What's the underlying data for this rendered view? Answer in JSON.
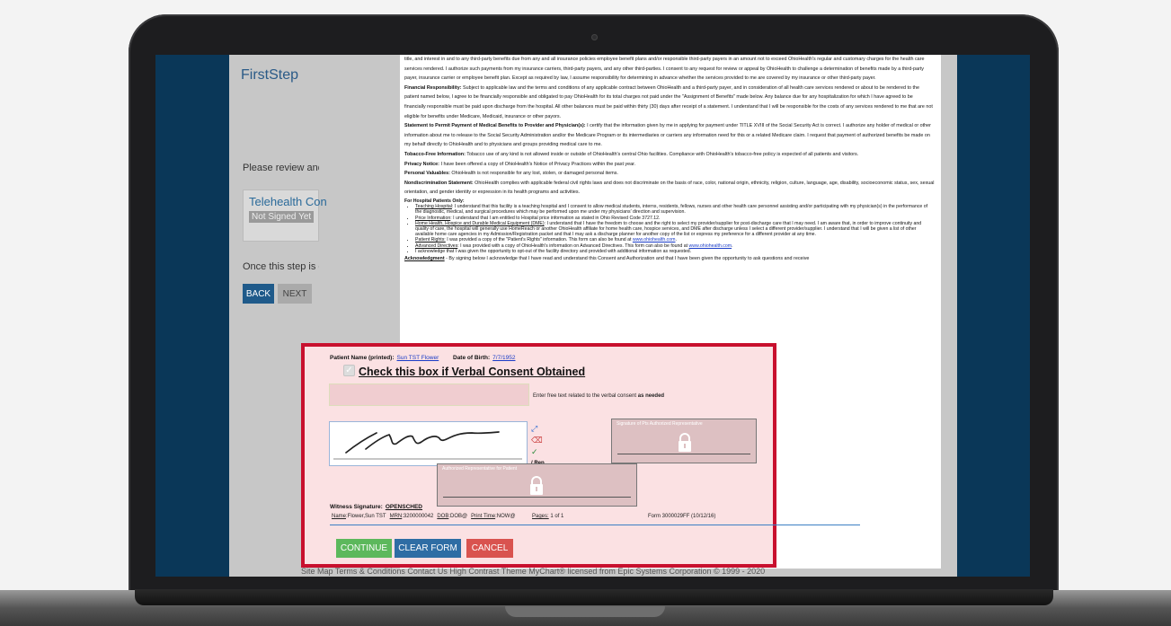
{
  "app": {
    "brand": "FirstStep",
    "review_text": "Please review and a",
    "doc_card_title": "Telehealth Con",
    "doc_card_status": "Not Signed Yet",
    "once_text": "Once this step is co",
    "back_label": "BACK",
    "next_label": "NEXT",
    "footer": "Site Map   Terms & Conditions   Contact Us   High Contrast Theme        MyChart® licensed from Epic Systems Corporation © 1999 - 2020"
  },
  "document": {
    "p1": "title, and interest in and to any third-party benefits due from any and all insurance policies employee benefit plans and/or responsible third-party payers in an amount not to exceed OhioHealth's regular and customary charges for the health care services rendered. I authorize such payments from my insurance carriers, third-party payers, and any other third-parties. I consent to any request for review or appeal by OhioHealth to challenge a determination of benefits made by a third-party payer, insurance carrier or employee benefit plan. Except as required by law, I assume responsibility for determining in advance whether the services provided to me are covered by my insurance or other third-party payer.",
    "financial_head": "Financial Responsibility:",
    "financial_body": " Subject to applicable law and the terms and conditions of any applicable contract between OhioHealth and a third-party payer, and in consideration of all health care services rendered or about to be rendered to the patient named below, I agree to be financially responsible and obligated to pay OhioHealth for its total charges not paid under the \"Assignment of Benefits\" made below. Any balance due for any hospitalization for which I have agreed to be financially responsible must be paid upon discharge from the hospital. All other balances must be paid within thirty (30) days after receipt of a statement. I understand that I will be responsible for the costs of any services rendered to me that are not eligible for benefits under Medicare, Medicaid, insurance or other payors.",
    "statement_head": "Statement to Permit Payment of Medical Benefits to Provider and Physician(s):",
    "statement_body": " I certify that the information given by me in applying for payment under TITLE XVIII of the Social Security Act is correct. I authorize any holder of medical or other information about me to release to the Social Security Administration and/or the Medicare Program or its intermediaries or carriers any information need for this or a related Medicare claim. I request that payment of authorized benefits be made on my behalf directly to OhioHealth and to physicians and groups providing medical care to me.",
    "tobacco_head": "Tobacco-Free Information:",
    "tobacco_body": " Tobacco use of any kind is not allowed inside or outside of OhioHealth's central Ohio facilities. Compliance with OhioHealth's tobacco-free policy is expected of all patients and visitors.",
    "privacy_head": "Privacy Notice:",
    "privacy_body": " I have been offered a copy of OhioHealth's Notice of Privacy Practices within the past year.",
    "valuables_head": "Personal Valuables:",
    "valuables_body": " OhioHealth is not responsible for any lost, stolen, or damaged personal items.",
    "nondisc_head": "Nondiscrimination Statement:",
    "nondisc_body": " OhioHealth complies with applicable federal civil rights laws and does not discriminate on the basis of race, color, national origin, ethnicity, religion, culture, language, age, disability, socioeconomic status, sex, sexual orientation, and gender identity or expression in its health programs and activities.",
    "hospital_head": "For Hospital Patients Only:",
    "b1_link": "Teaching Hospital",
    "b1_text": ": I understand that this facility is a teaching hospital and I consent to allow medical students, interns, residents, fellows, nurses and other health care personnel assisting and/or participating with my physician(s) in the performance of the diagnostic, medical, and surgical procedures which may be performed upon me under my physicians' direction and supervision.",
    "b2_link": "Price Information",
    "b2_text": ": I understand that I am entitled to Hospital price information as stated in Ohio Revised Code 3727.12.",
    "b3_link": "Home Health, Hospice and Durable Medical Equipment (DME)",
    "b3_text": ": I understand that I have the freedom to choose and the right to select my provider/supplier for post-discharge care that I may need.  I am aware that, in order to improve continuity and quality of care, the hospital will generally use HomeReach or another OhioHealth affiliate for home health care, hospice services, and DME after discharge unless I select a different provider/supplier.  I understand that I will be given a list of other available home care agencies in my Admission/Registration packet and that I may ask a discharge planner for another copy of the list or express my preference for a different provider at any time.",
    "b4_link": "Patient Rights:",
    "b4_text": "  I was provided a copy of the \"Patient's Rights\" information.  This form can also be found at ",
    "b4_url": "www.ohiohealth.com",
    "b5_link": "Advanced Directives",
    "b5_text": ":  I was provided with a copy of OhioHealth's information on Advanced Directives.  This form can also be found at ",
    "b5_url": "www.ohiohealth.com",
    "b6_text": "I acknowledge that I was given the opportunity to opt-out of the facility directory and provided with additional information as requested.",
    "ack_head": "Acknowledgment",
    "ack_body": " - By signing below I acknowledge that I have read and understand this Consent and Authorization and that I have been given the opportunity to ask questions and receive"
  },
  "signing": {
    "patient_label": "Patient Name (printed):",
    "patient_value": "Sun TST Flower",
    "dob_label": "Date of Birth:",
    "dob_value": "7/7/1952",
    "verbal_title": "Check this box if Verbal Consent Obtained",
    "free_text_label": "Enter free text related to the verbal consent ",
    "free_text_label_bold": "as needed",
    "rep_tag": "/ Rep",
    "authorized_rep_sig_label": "Signature of Pts Authorized Representative",
    "authorized_rep_label": "Authorized Representative for Patient",
    "witness_label": "Witness Signature:",
    "witness_value": "OPENSCHED",
    "meta_name_label": "Name",
    "meta_name": ":Flower,Sun TST",
    "meta_mrn_label": "MRN",
    "meta_mrn": ":3200000042",
    "meta_dob_label": "DOB",
    "meta_dob": ":DOB@",
    "meta_print_label": "Print Time",
    "meta_print": ":NOW@",
    "pages_label": "Pages:",
    "pages_value": " 1  of  1",
    "form_id": "Form 3000029FF (10/12/16)",
    "continue_label": "CONTINUE",
    "clear_label": "CLEAR FORM",
    "cancel_label": "CANCEL"
  },
  "colors": {
    "panel_border": "#c8102e",
    "panel_bg": "#fbe1e3",
    "continue": "#5cb85c",
    "clear": "#2e6da4",
    "cancel": "#d9534f"
  }
}
